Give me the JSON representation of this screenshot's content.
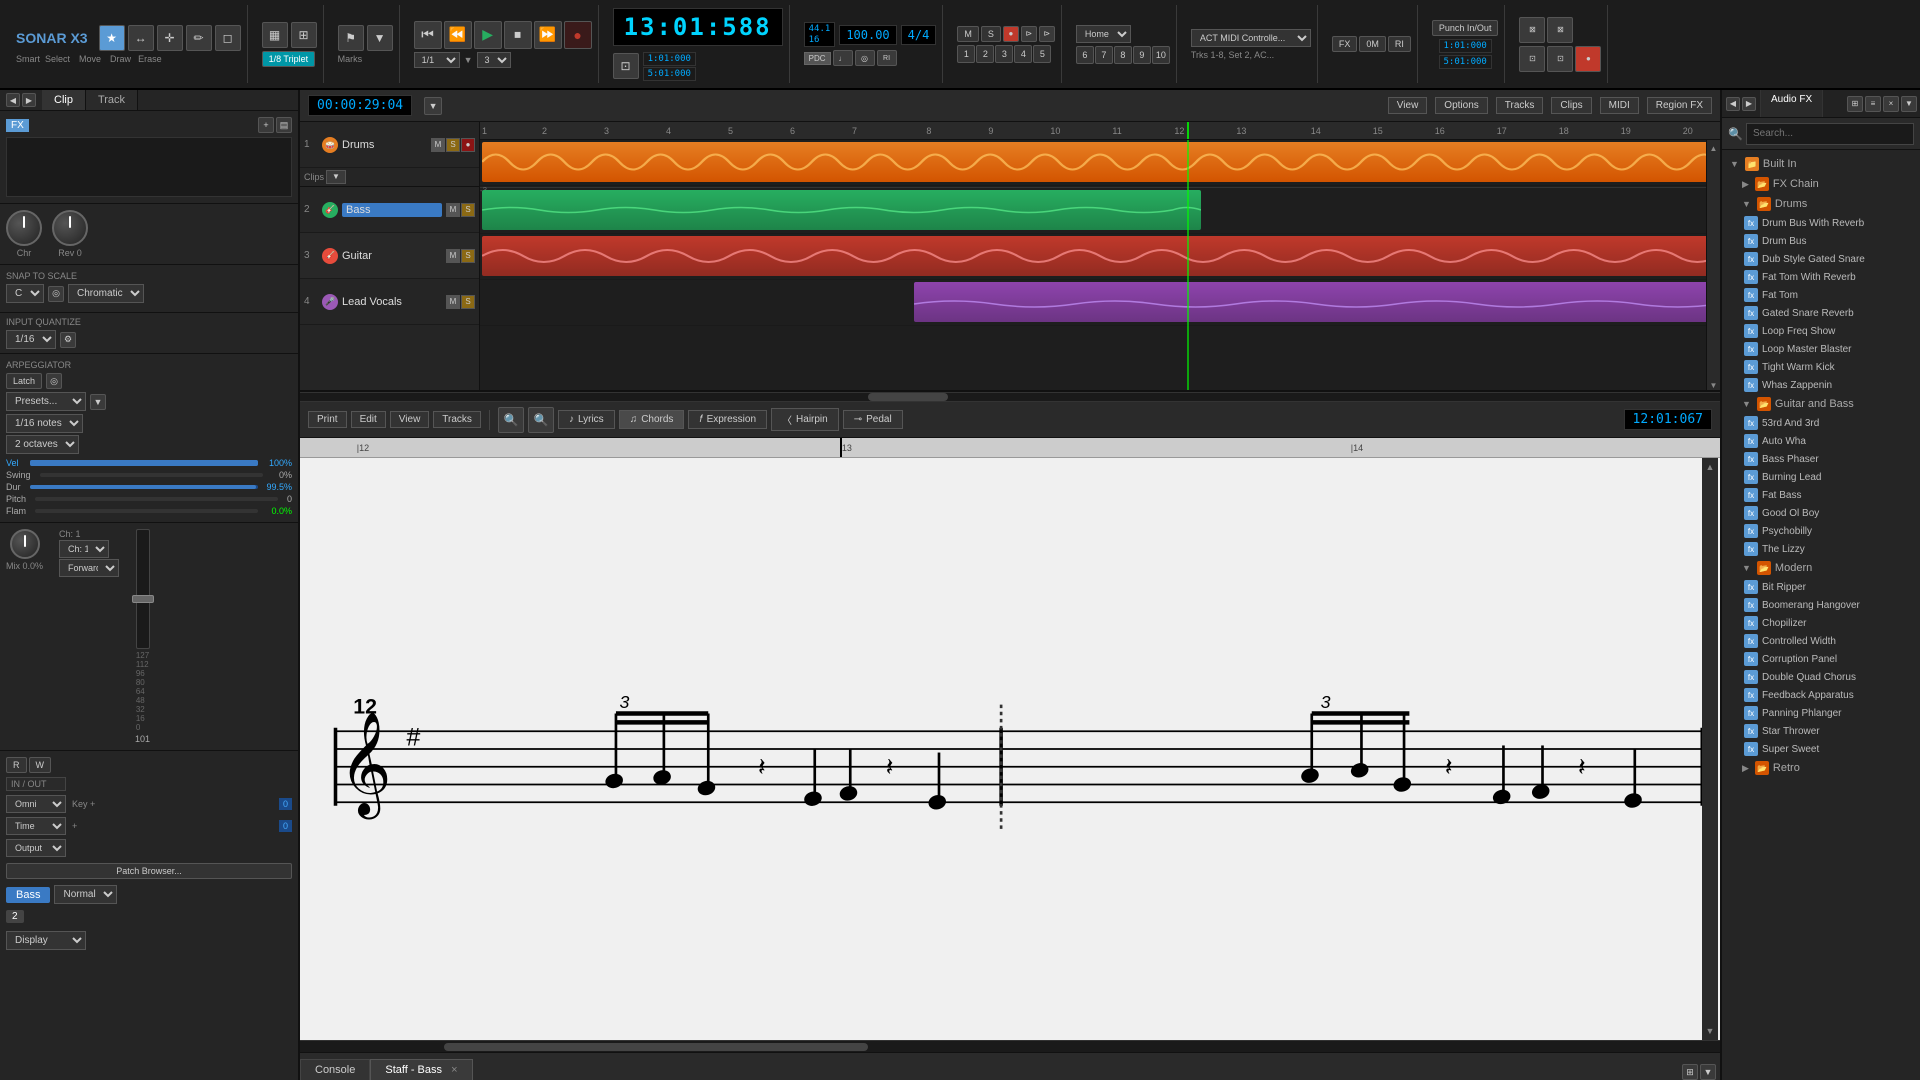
{
  "app": {
    "title": "SONAR X3",
    "logo": "SONAR X3"
  },
  "toolbar": {
    "tools": [
      "Smart",
      "Select",
      "Move",
      "Draw",
      "Erase"
    ],
    "snap_value": "1/8 Triplet",
    "quantize": "1/1",
    "swing": "3"
  },
  "transport": {
    "time": "13:01:588",
    "position": "00:00:29:04",
    "loop_start": "1:01:000",
    "loop_end": "5:01:000",
    "tempo": "100.00",
    "time_sig": "4/4",
    "sample_rate": "44.1",
    "bit_depth": "16"
  },
  "left_panel": {
    "tabs": [
      "Clip",
      "Track"
    ],
    "snap_to_scale": {
      "label": "SNAP TO SCALE",
      "key": "C",
      "mode": "Chromatic"
    },
    "input_quantize": {
      "label": "INPUT QUANTIZE",
      "value": "1/16"
    },
    "arpeggiator": {
      "label": "ARPEGGIATOR",
      "latch": "Latch",
      "presets": "Presets...",
      "notes": "1/16 notes",
      "octaves": "2 octaves",
      "vel": "100%",
      "swing": "0%",
      "dur": "99.5%",
      "pitch": "0",
      "flam": "0.0%"
    },
    "mix": "Mix 0.0%",
    "channel": "Ch: 1",
    "forward": "Forward",
    "in_out": "IN / OUT",
    "key": "Key +",
    "time": "Time +",
    "output": "Output",
    "patch_browser": "Patch Browser...",
    "normal": "Normal",
    "channel_name": "Bass",
    "channel_num": "2",
    "display": "Display"
  },
  "tracks": [
    {
      "num": "1",
      "name": "Drums",
      "type": "drums",
      "clip_type": "drums"
    },
    {
      "num": "2",
      "name": "Bass",
      "type": "bass",
      "clip_type": "bass"
    },
    {
      "num": "3",
      "name": "Guitar",
      "type": "guitar",
      "clip_type": "guitar"
    },
    {
      "num": "4",
      "name": "Lead Vocals",
      "type": "vocals",
      "clip_type": "vocals"
    }
  ],
  "staff": {
    "toolbar_buttons": [
      "Lyrics",
      "Chords",
      "Expression",
      "Hairpin",
      "Pedal"
    ],
    "time_display": "12:01:067",
    "ruler_marks": [
      "|12",
      "|13",
      "|14"
    ]
  },
  "tabs": [
    {
      "label": "Console",
      "closeable": false
    },
    {
      "label": "Staff - Bass",
      "closeable": true
    }
  ],
  "right_panel": {
    "tabs": [
      "Audio FX"
    ],
    "search_placeholder": "Search...",
    "tree": {
      "root": "Built In",
      "fx_chain": "FX Chain",
      "folders": [
        {
          "name": "Drums",
          "items": [
            "Drum Bus With Reverb",
            "Drum Bus",
            "Dub Style Gated Snare",
            "Fat Tom With Reverb",
            "Fat Tom",
            "Gated Snare Reverb",
            "Loop Freq Show",
            "Loop Master Blaster",
            "Tight Warm Kick",
            "Whas Zappenin"
          ]
        },
        {
          "name": "Guitar and Bass",
          "items": [
            "53rd And 3rd",
            "Auto Wha",
            "Bass Phaser",
            "Burning Lead",
            "Fat Bass",
            "Good Ol Boy",
            "Psychobilly",
            "The Lizzy"
          ]
        },
        {
          "name": "Modern",
          "items": [
            "Bit Ripper",
            "Boomerang Hangover",
            "Chopilizer",
            "Controlled Width",
            "Corruption Panel",
            "Double Quad Chorus",
            "Feedback Apparatus",
            "Panning Phlanger",
            "Star Thrower",
            "Super Sweet"
          ]
        },
        {
          "name": "Retro",
          "items": []
        }
      ]
    }
  },
  "header_buttons": {
    "view": "View",
    "options": "Options",
    "tracks": "Tracks",
    "clips": "Clips",
    "midi": "MIDI",
    "region_fx": "Region FX",
    "print": "Print",
    "edit": "Edit"
  },
  "act_midi": "ACT MIDI Controlle...",
  "home": "Home",
  "trks_label": "Trks 1-8, Set 2, AC...",
  "punch_label": "Punch In/Out",
  "punch_time": "1:01:000",
  "punch_end": "5:01:000"
}
